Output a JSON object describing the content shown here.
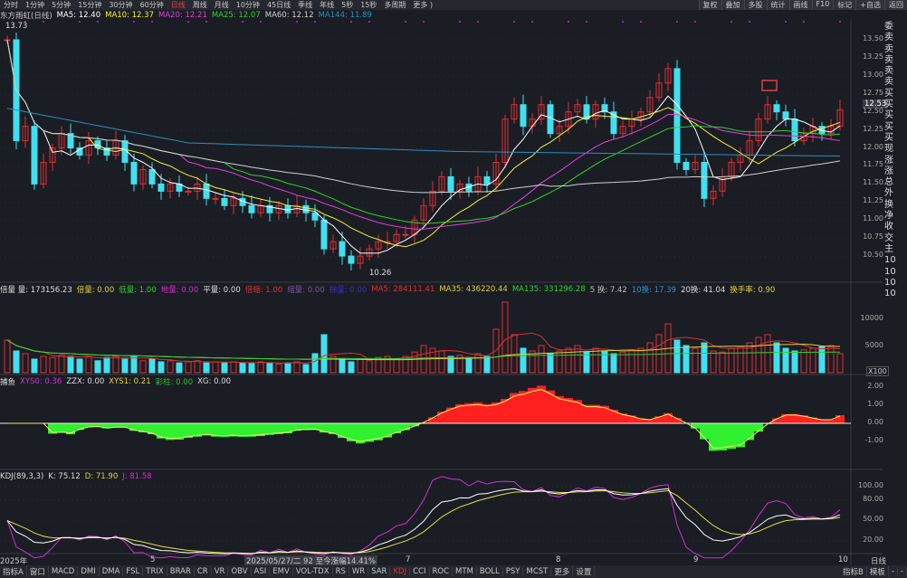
{
  "toolbar": {
    "periods": [
      "分时",
      "1分钟",
      "5分钟",
      "15分钟",
      "30分钟",
      "60分钟",
      "日线",
      "周线",
      "月线",
      "10分钟",
      "45日线",
      "季线",
      "年线",
      "5秒",
      "15秒",
      "多周期",
      "更多 )"
    ],
    "active": "日线",
    "right_buttons": [
      "复权",
      "叠加",
      "多股",
      "统计",
      "画线",
      "F10",
      "标记",
      "+自选",
      "返回"
    ]
  },
  "main_legend": {
    "name": "东方雨虹(日线)",
    "ma": [
      {
        "label": "MA5: 12.40",
        "color": "#ffffff"
      },
      {
        "label": "MA10: 12.37",
        "color": "#f0f040"
      },
      {
        "label": "MA20: 12.21",
        "color": "#e040e0"
      },
      {
        "label": "MA25: 12.07",
        "color": "#30d030"
      },
      {
        "label": "MA60: 12.12",
        "color": "#d0d0d0"
      },
      {
        "label": "MA144: 11.89",
        "color": "#2a8fc0"
      }
    ],
    "high_label": "13.73",
    "low_label": "10.26",
    "current_price": "12.53"
  },
  "price_axis": [
    "13.50",
    "13.25",
    "13.00",
    "12.75",
    "12.50",
    "12.25",
    "12.00",
    "11.75",
    "11.50",
    "11.25",
    "11.00",
    "10.75",
    "10.50"
  ],
  "volume_legend": [
    {
      "t": "倍量 量: 173156.23",
      "c": "#dddddd"
    },
    {
      "t": "倍量: 0.00",
      "c": "#e0d040"
    },
    {
      "t": "低量: 1.00",
      "c": "#30d030"
    },
    {
      "t": "地量: 0.00",
      "c": "#d030d0"
    },
    {
      "t": "平量: 0.00",
      "c": "#dddddd"
    },
    {
      "t": "倍缩: 1.00",
      "c": "#e03030"
    },
    {
      "t": "缩量: 0.00",
      "c": "#8050a0"
    },
    {
      "t": "梯量: 0.00",
      "c": "#3030c0"
    },
    {
      "t": "MA5: 284111.41",
      "c": "#e03030"
    },
    {
      "t": "MA35: 436220.44",
      "c": "#e0d040"
    },
    {
      "t": "MA135: 331296.28",
      "c": "#30d030"
    },
    {
      "t": "5 换: 7.42",
      "c": "#bbbbbb"
    },
    {
      "t": "10换: 17.39",
      "c": "#3090d0"
    },
    {
      "t": "20换: 41.04",
      "c": "#dddddd"
    },
    {
      "t": "换手率: 0.90",
      "c": "#e0d040"
    }
  ],
  "volume_axis": [
    "10000",
    "5000"
  ],
  "volume_unit": "X100",
  "ind_legend": [
    {
      "t": "捕鱼",
      "c": "#dddddd"
    },
    {
      "t": "XYS0: 0.36",
      "c": "#d030d0"
    },
    {
      "t": "ZZX: 0.00",
      "c": "#dddddd"
    },
    {
      "t": "XYS1: 0.21",
      "c": "#e0d040"
    },
    {
      "t": "彩柱: 0.00",
      "c": "#30c030"
    },
    {
      "t": "XG: 0.00",
      "c": "#dddddd"
    }
  ],
  "ind_axis": [
    "2.00",
    "1.00",
    "0.00",
    "-1.00"
  ],
  "kdj_legend": [
    {
      "t": "KDJ(89,3,3)",
      "c": "#dddddd"
    },
    {
      "t": "K: 75.12",
      "c": "#dddddd"
    },
    {
      "t": "D: 71.90",
      "c": "#e0d040"
    },
    {
      "t": "J: 81.58",
      "c": "#d030d0"
    }
  ],
  "kdj_axis": [
    "100.00",
    "80.00",
    "50.00",
    "20.00"
  ],
  "date_axis": [
    "2025年",
    "5",
    "7",
    "8",
    "9",
    "10"
  ],
  "date_tooltip": "2025/05/27/二 92 至今涨幅14.41%",
  "period_label": "日线",
  "right_column": [
    "委",
    "卖",
    "卖",
    "卖",
    "卖",
    "卖",
    "买",
    "买",
    "买",
    "买",
    "买",
    "现",
    "涨",
    "涨",
    "总",
    "外",
    "换",
    "净",
    "收",
    "交",
    "主",
    "10",
    "10",
    "10",
    "10"
  ],
  "bottom_tabs": [
    "指标A",
    "窗口",
    "MACD",
    "DMI",
    "DMA",
    "FSL",
    "TRIX",
    "BRAR",
    "CR",
    "VR",
    "OBV",
    "ASI",
    "EMV",
    "VOL-TDX",
    "RS",
    "WR",
    "SAR",
    "KDJ",
    "CCI",
    "ROC",
    "MTM",
    "BOLL",
    "PSY",
    "MCST",
    "更多",
    "设置"
  ],
  "bottom_active": "KDJ",
  "bottom_right": [
    "指标B",
    "模板",
    "-",
    "-"
  ],
  "chart_data": {
    "type": "candlestick",
    "price_range": [
      10.2,
      13.8
    ],
    "close": [
      13.5,
      12.1,
      12.3,
      11.5,
      11.8,
      12.0,
      12.2,
      12.0,
      11.9,
      12.1,
      12.0,
      11.9,
      12.1,
      11.8,
      11.5,
      11.7,
      11.5,
      11.4,
      11.5,
      11.4,
      11.4,
      11.5,
      11.3,
      11.3,
      11.2,
      11.3,
      11.2,
      11.1,
      11.2,
      11.1,
      11.2,
      11.1,
      11.2,
      11.1,
      11.0,
      10.6,
      10.7,
      10.5,
      10.4,
      10.5,
      10.6,
      10.7,
      10.7,
      10.8,
      10.8,
      11.0,
      11.2,
      11.4,
      11.6,
      11.4,
      11.5,
      11.4,
      11.6,
      11.5,
      11.8,
      12.4,
      12.6,
      12.3,
      12.4,
      12.6,
      12.2,
      12.3,
      12.5,
      12.6,
      12.4,
      12.6,
      12.5,
      12.2,
      12.3,
      12.4,
      12.5,
      12.7,
      12.9,
      13.1,
      11.8,
      11.7,
      11.8,
      11.3,
      11.4,
      11.6,
      11.8,
      11.9,
      12.1,
      12.4,
      12.6,
      12.5,
      12.4,
      12.1,
      12.2,
      12.3,
      12.2,
      12.3,
      12.53
    ],
    "volume": [
      60,
      40,
      35,
      25,
      30,
      28,
      32,
      30,
      25,
      30,
      22,
      28,
      30,
      25,
      30,
      22,
      25,
      20,
      22,
      18,
      20,
      22,
      18,
      20,
      18,
      20,
      18,
      17,
      20,
      18,
      16,
      18,
      20,
      15,
      35,
      70,
      30,
      25,
      20,
      25,
      22,
      28,
      30,
      25,
      30,
      38,
      50,
      45,
      40,
      30,
      32,
      28,
      35,
      30,
      80,
      130,
      70,
      45,
      40,
      50,
      35,
      40,
      45,
      50,
      38,
      45,
      40,
      35,
      38,
      42,
      45,
      55,
      70,
      90,
      60,
      50,
      45,
      55,
      40,
      38,
      45,
      48,
      55,
      65,
      70,
      55,
      45,
      40,
      42,
      45,
      48,
      50,
      35
    ]
  }
}
